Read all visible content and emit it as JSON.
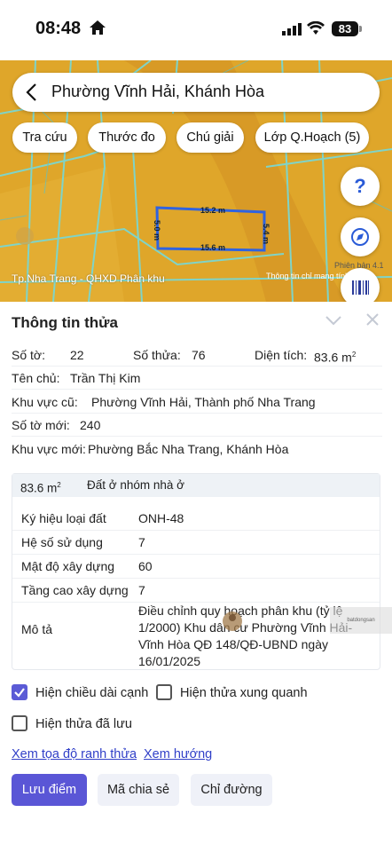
{
  "status_bar": {
    "time": "08:48",
    "battery": "83"
  },
  "map": {
    "search_title": "Phường Vĩnh Hải, Khánh Hòa",
    "chips": [
      "Tra cứu",
      "Thước đo",
      "Chú giải",
      "Lớp Q.Hoạch (5)"
    ],
    "help_label": "?",
    "version": "Phiên bản 4.1",
    "caption": "Tp.Nha Trang - QHXD Phân khu",
    "note": "Thông tin chỉ mang tính...",
    "dims": {
      "top": "15.2 m",
      "bottom": "15.6 m",
      "left": "5.0 m",
      "right": "5.4 m"
    },
    "colors": {
      "zone": "#e1a92a",
      "road": "#7fd4c8",
      "parcel": "#2f63e0"
    },
    "icons": [
      "back-arrow-icon",
      "help-icon",
      "compass-icon",
      "barcode-icon"
    ]
  },
  "sheet": {
    "title": "Thông tin thửa",
    "so_to_label": "Số tờ:",
    "so_to": "22",
    "so_thua_label": "Số thửa:",
    "so_thua": "76",
    "dien_tich_label": "Diện tích:",
    "dien_tich": "83.6 m",
    "dien_tich_unit_sup": "2",
    "ten_chu_label": "Tên chủ:",
    "ten_chu": "Trần Thị Kim",
    "khu_vuc_cu_label": "Khu vực cũ:",
    "khu_vuc_cu": "Phường Vĩnh Hải, Thành phố Nha Trang",
    "so_to_moi_label": "Số tờ mới:",
    "so_to_moi": "240",
    "khu_vuc_moi_label": "Khu vực mới:",
    "khu_vuc_moi": "Phường Bắc Nha Trang, Khánh Hòa",
    "table": {
      "area": "83.6 m",
      "area_sup": "2",
      "land_type": "Đất ở nhóm nhà ở",
      "rows": [
        {
          "key": "Ký hiệu loại đất",
          "value": "ONH-48"
        },
        {
          "key": "Hệ số sử dụng",
          "value": "7"
        },
        {
          "key": "Mật độ xây dựng",
          "value": "60"
        },
        {
          "key": "Tầng cao xây dựng",
          "value": "7"
        }
      ],
      "desc_label": "Mô tả",
      "desc": "Điều chỉnh quy hoạch phân khu (tỷ lệ 1/2000) Khu dân cư Phường Vĩnh Hải- Vĩnh Hòa QĐ 148/QĐ-UBND ngày 16/01/2025",
      "watermark": "batdongsan"
    },
    "checks": {
      "show_edges": "Hiện chiều dài cạnh",
      "show_neighbors": "Hiện thửa xung quanh",
      "show_saved": "Hiện thửa đã lưu"
    },
    "links": {
      "coords": "Xem tọa độ ranh thửa",
      "direction": "Xem hướng"
    },
    "buttons": {
      "save": "Lưu điểm",
      "share": "Mã chia sẻ",
      "route": "Chỉ đường"
    }
  }
}
